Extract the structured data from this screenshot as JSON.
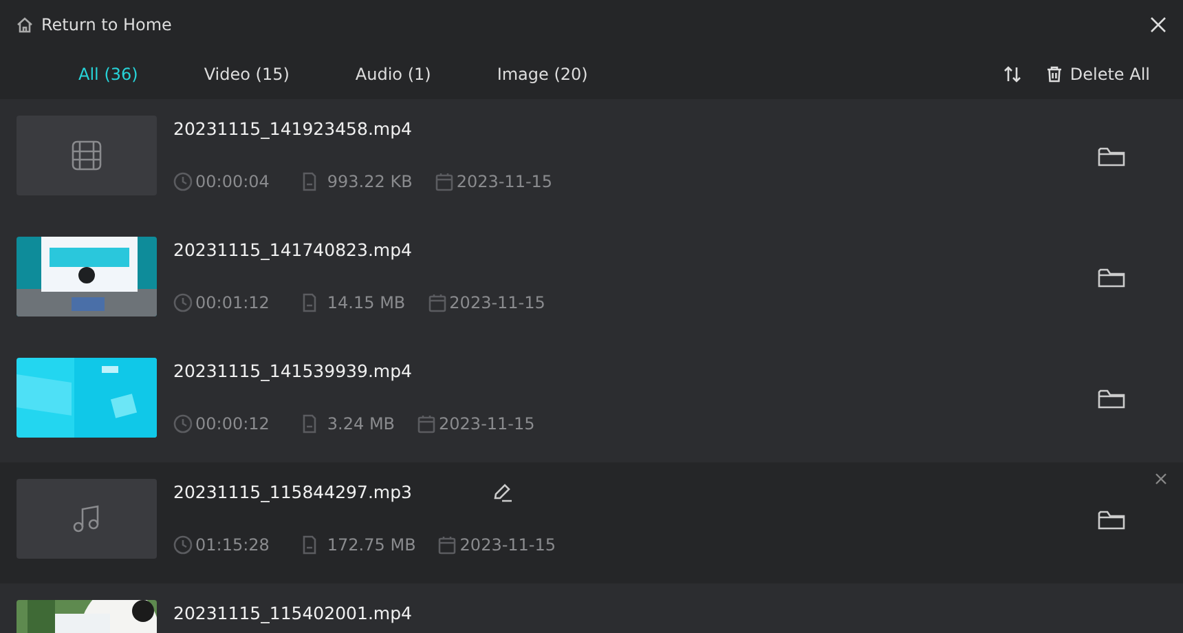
{
  "header": {
    "back_label": "Return to Home"
  },
  "tabs": [
    {
      "label": "All (36)",
      "selected": true
    },
    {
      "label": "Video (15)",
      "selected": false
    },
    {
      "label": "Audio (1)",
      "selected": false
    },
    {
      "label": "Image (20)",
      "selected": false
    }
  ],
  "delete_all_label": "Delete All",
  "files": [
    {
      "name": "20231115_141923458.mp4",
      "kind": "video",
      "duration": "00:00:04",
      "size": "993.22 KB",
      "date": "2023-11-15",
      "hovered": false
    },
    {
      "name": "20231115_141740823.mp4",
      "kind": "picture",
      "duration": "00:01:12",
      "size": "14.15 MB",
      "date": "2023-11-15",
      "hovered": false
    },
    {
      "name": "20231115_141539939.mp4",
      "kind": "picture",
      "duration": "00:00:12",
      "size": "3.24 MB",
      "date": "2023-11-15",
      "hovered": false
    },
    {
      "name": "20231115_115844297.mp3",
      "kind": "audio",
      "duration": "01:15:28",
      "size": "172.75 MB",
      "date": "2023-11-15",
      "hovered": true
    },
    {
      "name": "20231115_115402001.mp4",
      "kind": "picture",
      "hovered": false
    }
  ]
}
